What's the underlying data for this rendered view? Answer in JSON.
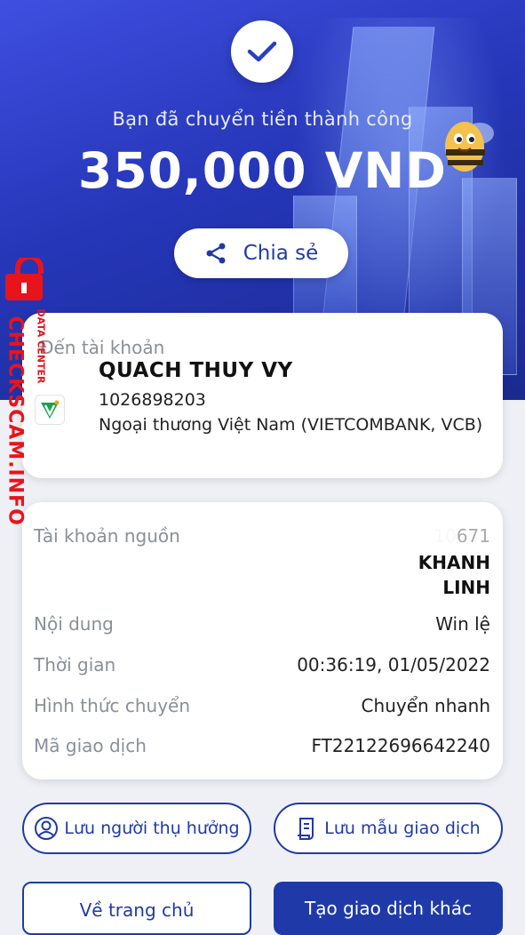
{
  "header": {
    "success_message": "Bạn đã chuyển tiền thành công",
    "amount": "350,000 VND",
    "share_label": "Chia sẻ"
  },
  "recipient": {
    "label": "Đến tài khoản",
    "name": "QUACH THUY VY",
    "account_number": "1026898203",
    "bank": "Ngoại thương Việt Nam (VIETCOMBANK, VCB)"
  },
  "details": {
    "source_account_label": "Tài khoản nguồn",
    "source_account_partial": "10671",
    "source_name_line1": "KHANH",
    "source_name_line2": "LINH",
    "content_label": "Nội dung",
    "content_value": "Win lệ",
    "time_label": "Thời gian",
    "time_value": "00:36:19, 01/05/2022",
    "method_label": "Hình thức chuyển",
    "method_value": "Chuyển nhanh",
    "txn_code_label": "Mã giao dịch",
    "txn_code_value": "FT22122696642240"
  },
  "actions": {
    "save_payee": "Lưu người thụ hưởng",
    "save_template": "Lưu mẫu giao dịch",
    "home": "Về trang chủ",
    "new_transaction": "Tạo giao dịch khác"
  },
  "watermark": {
    "main": "CHECKSCAM.INFO",
    "sub": "DATA CENTER"
  },
  "colors": {
    "primary": "#1f3aa8",
    "hero_gradient_start": "#3f4fe0",
    "hero_gradient_end": "#1b2a8e",
    "watermark": "#e8141c"
  }
}
